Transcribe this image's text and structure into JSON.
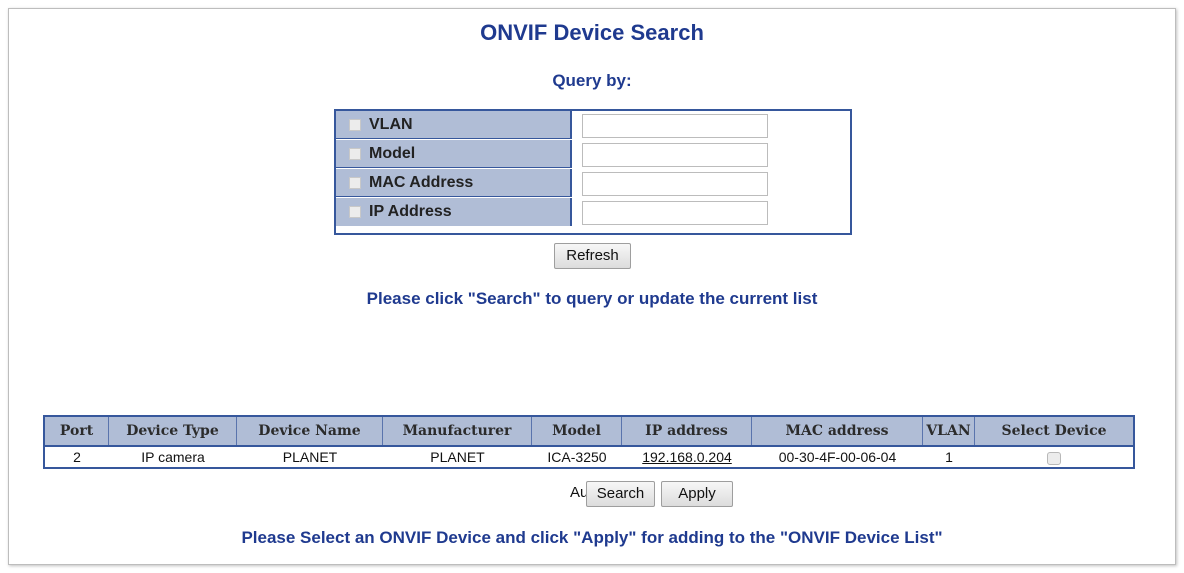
{
  "page": {
    "title": "ONVIF Device Search",
    "query_by_label": "Query by:"
  },
  "query_fields": [
    {
      "label": "VLAN",
      "checked": false,
      "value": ""
    },
    {
      "label": "Model",
      "checked": false,
      "value": ""
    },
    {
      "label": "MAC Address",
      "checked": false,
      "value": ""
    },
    {
      "label": "IP Address",
      "checked": false,
      "value": ""
    }
  ],
  "buttons": {
    "refresh": "Refresh",
    "search": "Search",
    "apply": "Apply"
  },
  "messages": {
    "search_hint": "Please click \"Search\" to query or update the current list",
    "apply_hint": "Please Select an ONVIF Device and click \"Apply\" for adding to the \"ONVIF Device List\""
  },
  "results_table": {
    "columns": [
      "Port",
      "Device Type",
      "Device Name",
      "Manufacturer",
      "Model",
      "IP address",
      "MAC address",
      "VLAN",
      "Select Device"
    ],
    "rows": [
      {
        "port": "2",
        "device_type": "IP camera",
        "device_name": "PLANET",
        "manufacturer": "PLANET",
        "model": "ICA-3250",
        "ip_address": "192.168.0.204",
        "mac_address": "00-30-4F-00-06-04",
        "vlan": "1",
        "selected": false
      }
    ]
  },
  "auto_search": {
    "label": "Auto Search",
    "checked": false
  },
  "colors": {
    "heading": "#1f3a8f",
    "table_border": "#36579c",
    "header_fill": "#b0bdd6"
  }
}
